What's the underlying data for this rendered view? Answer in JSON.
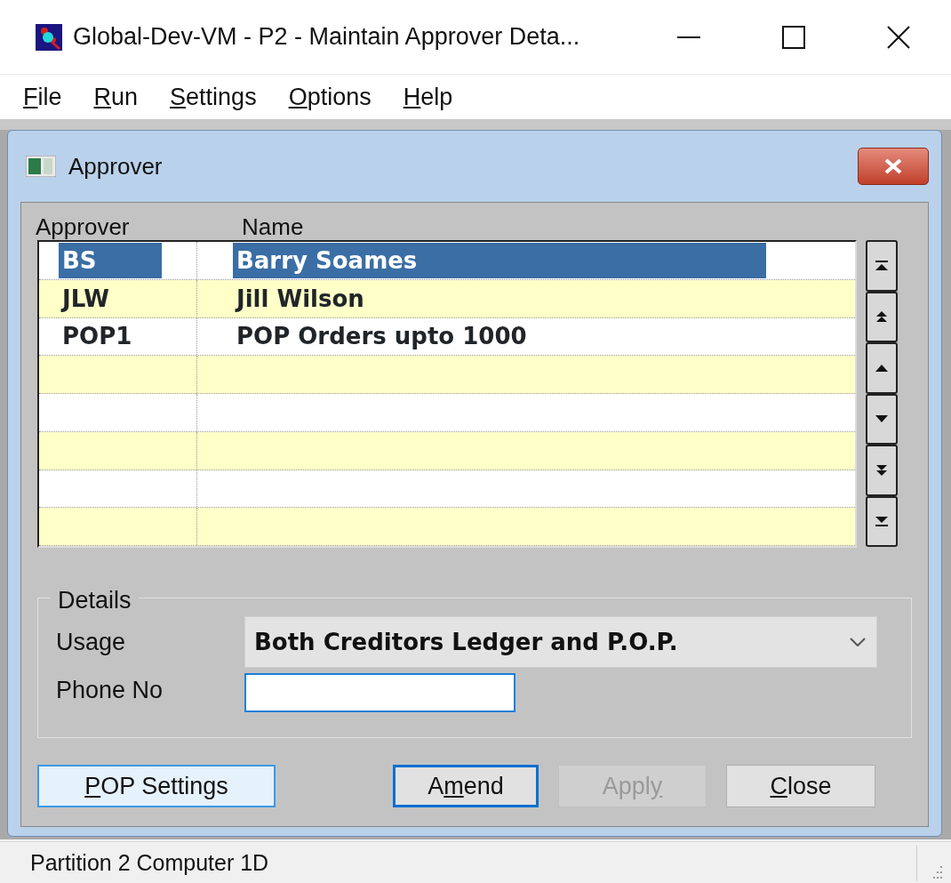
{
  "window": {
    "title": "Global-Dev-VM - P2 - Maintain Approver Deta..."
  },
  "menu": [
    {
      "accel": "F",
      "rest": "ile"
    },
    {
      "accel": "R",
      "rest": "un"
    },
    {
      "accel": "S",
      "rest": "ettings"
    },
    {
      "accel": "O",
      "rest": "ptions"
    },
    {
      "accel": "H",
      "rest": "elp"
    }
  ],
  "dialog": {
    "title": "Approver",
    "table": {
      "columns": [
        "Approver",
        "Name"
      ],
      "rows": [
        {
          "code": "BS",
          "name": "Barry Soames",
          "selected": true
        },
        {
          "code": "JLW",
          "name": "Jill Wilson",
          "selected": false
        },
        {
          "code": "POP1",
          "name": "POP Orders upto 1000",
          "selected": false
        }
      ]
    },
    "details": {
      "title": "Details",
      "usage": {
        "label": "Usage",
        "value": "Both Creditors Ledger and P.O.P."
      },
      "phone": {
        "label": "Phone No",
        "focused": true
      }
    },
    "buttons": [
      {
        "accel": "P",
        "after": "OP Settings",
        "default": false,
        "hot": true,
        "disabled": false
      },
      {
        "before": "A",
        "accel": "m",
        "after": "end",
        "default": true,
        "hot": false,
        "disabled": false
      },
      {
        "before": "Appl",
        "accel": "y",
        "default": false,
        "hot": false,
        "disabled": true
      },
      {
        "accel": "C",
        "after": "lose",
        "default": false,
        "hot": false,
        "disabled": false
      }
    ]
  },
  "status_bar": {
    "text": "Partition 2 Computer 1D"
  }
}
